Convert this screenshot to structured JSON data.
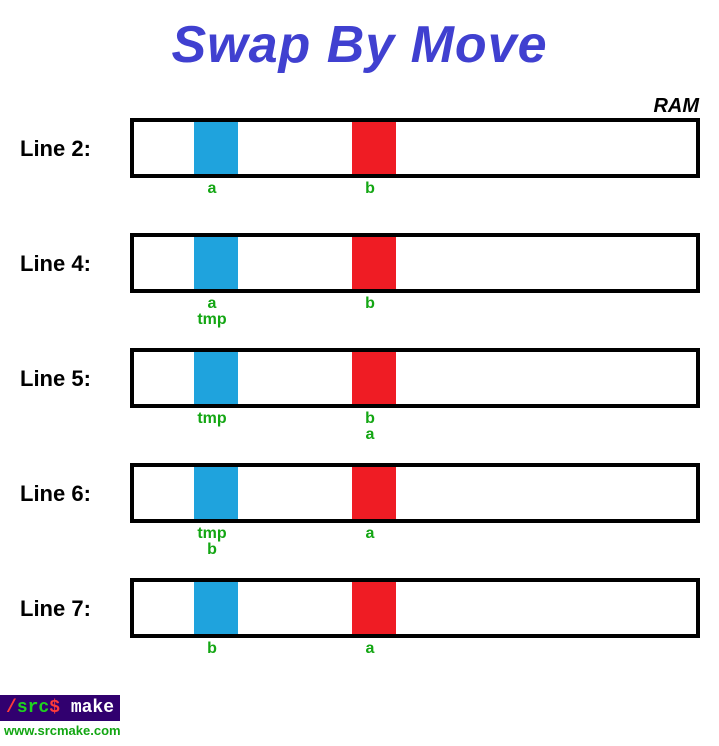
{
  "title": "Swap By Move",
  "ram_label": "RAM",
  "rows": [
    {
      "label": "Line 2:",
      "labels_a": [
        "a"
      ],
      "labels_b": [
        "b"
      ]
    },
    {
      "label": "Line 4:",
      "labels_a": [
        "a",
        "tmp"
      ],
      "labels_b": [
        "b"
      ]
    },
    {
      "label": "Line 5:",
      "labels_a": [
        "tmp"
      ],
      "labels_b": [
        "b",
        "a"
      ]
    },
    {
      "label": "Line 6:",
      "labels_a": [
        "tmp",
        "b"
      ],
      "labels_b": [
        "a"
      ]
    },
    {
      "label": "Line 7:",
      "labels_a": [
        "b"
      ],
      "labels_b": [
        "a"
      ]
    }
  ],
  "colors": {
    "title": "#4040d0",
    "block_a": "#1fa3dd",
    "block_b": "#ef1c24",
    "var_label": "#13a613"
  },
  "footer": {
    "badge_slash": "/",
    "badge_src": "src",
    "badge_dollar": "$",
    "badge_make": " make",
    "url": "www.srcmake.com"
  }
}
